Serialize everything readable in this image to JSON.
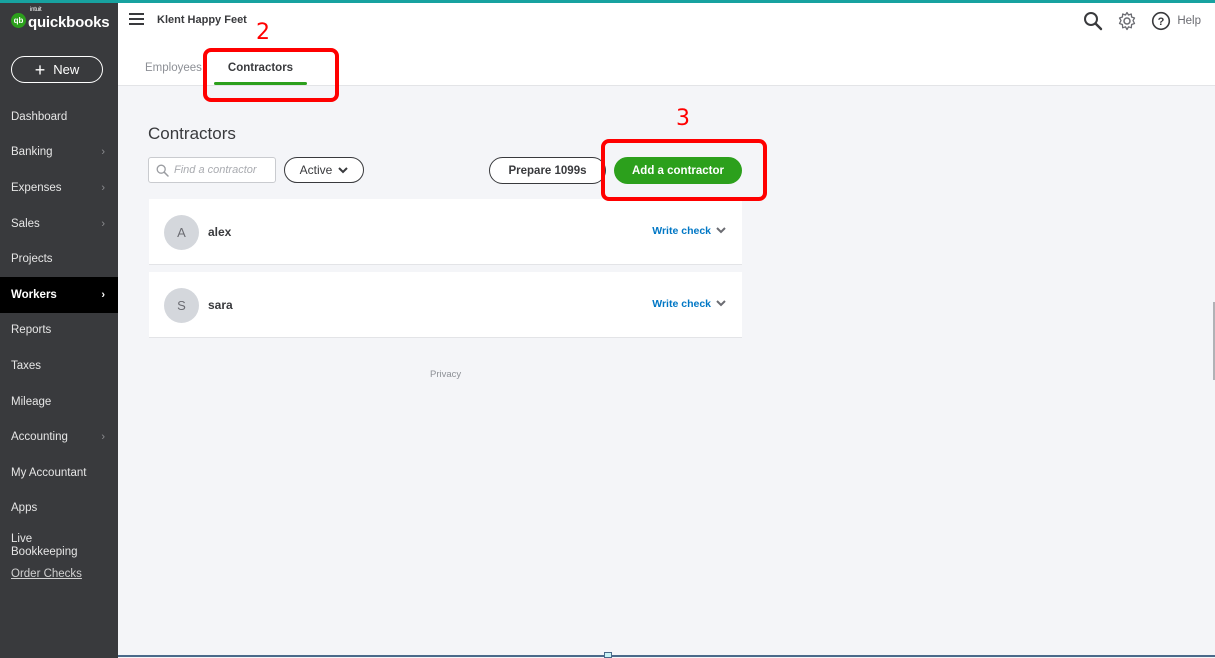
{
  "app": {
    "brand_small": "intuit",
    "brand": "quickbooks",
    "brand_badge": "qb",
    "company_name": "Klent Happy Feet",
    "accent_color": "#2ca01c",
    "topbar_color": "#17a2a0"
  },
  "sidebar": {
    "new_button": "New",
    "items": [
      {
        "label": "Dashboard",
        "has_chevron": false
      },
      {
        "label": "Banking",
        "has_chevron": true
      },
      {
        "label": "Expenses",
        "has_chevron": true
      },
      {
        "label": "Sales",
        "has_chevron": true
      },
      {
        "label": "Projects",
        "has_chevron": false
      },
      {
        "label": "Workers",
        "has_chevron": true,
        "active": true
      },
      {
        "label": "Reports",
        "has_chevron": false
      },
      {
        "label": "Taxes",
        "has_chevron": false
      },
      {
        "label": "Mileage",
        "has_chevron": false
      },
      {
        "label": "Accounting",
        "has_chevron": true
      },
      {
        "label": "My Accountant",
        "has_chevron": false
      },
      {
        "label": "Apps",
        "has_chevron": false
      },
      {
        "label": "Live Bookkeeping",
        "has_chevron": false
      },
      {
        "label": "Order Checks",
        "link": true
      }
    ]
  },
  "header": {
    "icons": [
      "search-icon",
      "gear-icon",
      "help-icon"
    ],
    "help_label": "Help",
    "tabs": [
      {
        "label": "Employees",
        "active": false
      },
      {
        "label": "Contractors",
        "active": true
      }
    ]
  },
  "main": {
    "title": "Contractors",
    "search_placeholder": "Find a contractor",
    "search_value": "",
    "status_filter": "Active",
    "prepare_button": "Prepare 1099s",
    "add_button": "Add a contractor",
    "contractors": [
      {
        "initial": "A",
        "name": "alex",
        "action": "Write check"
      },
      {
        "initial": "S",
        "name": "sara",
        "action": "Write check"
      }
    ],
    "footer_link": "Privacy"
  },
  "annotations": [
    {
      "number": "2",
      "target": "Contractors tab"
    },
    {
      "number": "3",
      "target": "Add a contractor button"
    }
  ]
}
